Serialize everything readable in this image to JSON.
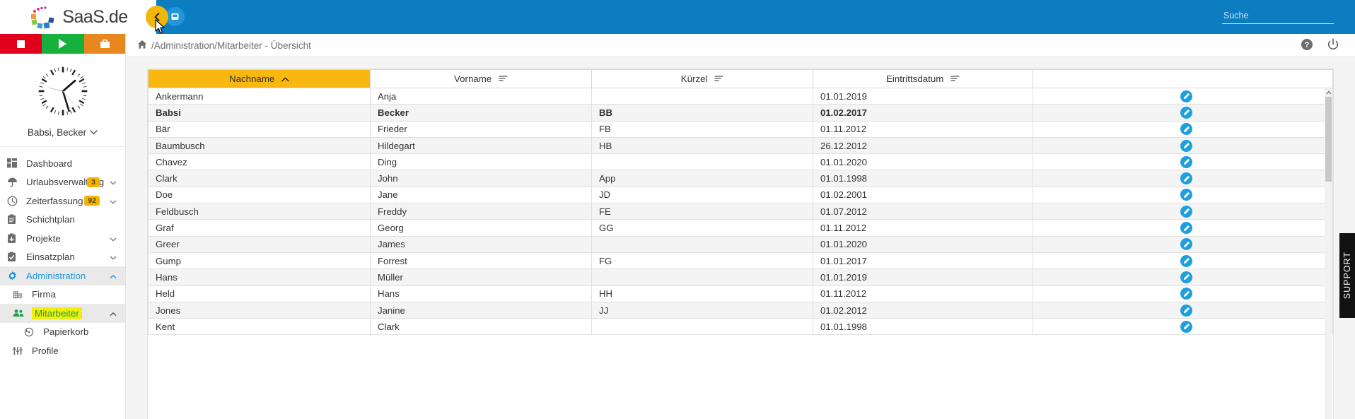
{
  "brand": {
    "name": "SaaS.de",
    "accent": "#0d7dc1",
    "highlight_yellow": "#f2b705"
  },
  "topbar": {
    "back_button": "collapse-sidebar",
    "add_button": "add",
    "window_button": "window",
    "search": {
      "placeholder": "Suche",
      "value": ""
    }
  },
  "sidebar": {
    "status_buttons": [
      {
        "name": "stop",
        "color": "#e3001b"
      },
      {
        "name": "start",
        "color": "#16b13c"
      },
      {
        "name": "break",
        "color": "#e8871e"
      }
    ],
    "user": {
      "name": "Babsi, Becker"
    },
    "items": [
      {
        "label": "Dashboard",
        "icon": "dashboard-icon",
        "badge": "",
        "chevron": false,
        "level": 0,
        "state": "normal"
      },
      {
        "label": "Urlaubsverwaltung",
        "icon": "umbrella-icon",
        "badge": "3",
        "chevron": true,
        "level": 0,
        "state": "normal"
      },
      {
        "label": "Zeiterfassung",
        "icon": "clock-icon",
        "badge": "92",
        "chevron": true,
        "level": 0,
        "state": "normal"
      },
      {
        "label": "Schichtplan",
        "icon": "clipboard-icon",
        "badge": "",
        "chevron": false,
        "level": 0,
        "state": "normal"
      },
      {
        "label": "Projekte",
        "icon": "projects-icon",
        "badge": "",
        "chevron": true,
        "level": 0,
        "state": "normal"
      },
      {
        "label": "Einsatzplan",
        "icon": "checklist-icon",
        "badge": "",
        "chevron": true,
        "level": 0,
        "state": "normal"
      },
      {
        "label": "Administration",
        "icon": "gear-icon",
        "badge": "",
        "chevron": true,
        "level": 0,
        "state": "active"
      },
      {
        "label": "Firma",
        "icon": "building-icon",
        "badge": "",
        "chevron": false,
        "level": 1,
        "state": "normal"
      },
      {
        "label": "Mitarbeiter",
        "icon": "users-icon",
        "badge": "",
        "chevron": true,
        "level": 1,
        "state": "highlight"
      },
      {
        "label": "Papierkorb",
        "icon": "restore-icon",
        "badge": "",
        "chevron": false,
        "level": 2,
        "state": "normal"
      },
      {
        "label": "Profile",
        "icon": "sliders-icon",
        "badge": "",
        "chevron": false,
        "level": 1,
        "state": "normal"
      }
    ]
  },
  "breadcrumb": {
    "home_icon": "home-icon",
    "path": "/Administration/Mitarbeiter - Übersicht",
    "help_icon": "help-icon",
    "power_icon": "power-icon"
  },
  "table": {
    "columns": [
      {
        "label": "Nachname",
        "sorted": true,
        "sort_dir": "asc",
        "icon": "chevron-up-icon"
      },
      {
        "label": "Vorname",
        "sorted": false,
        "sort_dir": "",
        "icon": "filter-icon"
      },
      {
        "label": "Kürzel",
        "sorted": false,
        "sort_dir": "",
        "icon": "filter-icon"
      },
      {
        "label": "Eintrittsdatum",
        "sorted": false,
        "sort_dir": "",
        "icon": "filter-icon"
      },
      {
        "label": "",
        "sorted": false,
        "sort_dir": "",
        "icon": ""
      }
    ],
    "rows": [
      {
        "nachname": "Ankermann",
        "vorname": "Anja",
        "kuerzel": "",
        "eintritt": "01.01.2019",
        "selected": false
      },
      {
        "nachname": "Babsi",
        "vorname": "Becker",
        "kuerzel": "BB",
        "eintritt": "01.02.2017",
        "selected": true
      },
      {
        "nachname": "Bär",
        "vorname": "Frieder",
        "kuerzel": "FB",
        "eintritt": "01.11.2012",
        "selected": false
      },
      {
        "nachname": "Baumbusch",
        "vorname": "Hildegart",
        "kuerzel": "HB",
        "eintritt": "26.12.2012",
        "selected": false
      },
      {
        "nachname": "Chavez",
        "vorname": "Ding",
        "kuerzel": "",
        "eintritt": "01.01.2020",
        "selected": false
      },
      {
        "nachname": "Clark",
        "vorname": "John",
        "kuerzel": "App",
        "eintritt": "01.01.1998",
        "selected": false
      },
      {
        "nachname": "Doe",
        "vorname": "Jane",
        "kuerzel": "JD",
        "eintritt": "01.02.2001",
        "selected": false
      },
      {
        "nachname": "Feldbusch",
        "vorname": "Freddy",
        "kuerzel": "FE",
        "eintritt": "01.07.2012",
        "selected": false
      },
      {
        "nachname": "Graf",
        "vorname": "Georg",
        "kuerzel": "GG",
        "eintritt": "01.11.2012",
        "selected": false
      },
      {
        "nachname": "Greer",
        "vorname": "James",
        "kuerzel": "",
        "eintritt": "01.01.2020",
        "selected": false
      },
      {
        "nachname": "Gump",
        "vorname": "Forrest",
        "kuerzel": "FG",
        "eintritt": "01.01.2017",
        "selected": false
      },
      {
        "nachname": "Hans",
        "vorname": "Müller",
        "kuerzel": "",
        "eintritt": "01.01.2019",
        "selected": false
      },
      {
        "nachname": "Held",
        "vorname": "Hans",
        "kuerzel": "HH",
        "eintritt": "01.11.2012",
        "selected": false
      },
      {
        "nachname": "Jones",
        "vorname": "Janine",
        "kuerzel": "JJ",
        "eintritt": "01.02.2012",
        "selected": false
      },
      {
        "nachname": "Kent",
        "vorname": "Clark",
        "kuerzel": "",
        "eintritt": "01.01.1998",
        "selected": false
      }
    ],
    "row_action_icon": "edit-pencil-icon"
  },
  "support_tab": {
    "label": "SUPPORT"
  }
}
